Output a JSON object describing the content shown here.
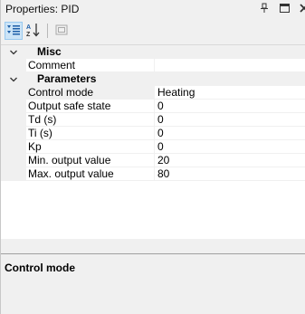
{
  "window": {
    "title": "Properties: PID"
  },
  "toolbar": {
    "categorized_icon": "categorized-icon",
    "alphabetical_icon": "sort-az-icon",
    "property_pages_icon": "property-pages-icon"
  },
  "grid": {
    "categories": [
      {
        "label": "Misc",
        "expanded": true,
        "properties": [
          {
            "name": "Comment",
            "value": ""
          }
        ]
      },
      {
        "label": "Parameters",
        "expanded": true,
        "properties": [
          {
            "name": "Control mode",
            "value": "Heating"
          },
          {
            "name": "Output safe state",
            "value": "0"
          },
          {
            "name": "Td (s)",
            "value": "0"
          },
          {
            "name": "Ti (s)",
            "value": "0"
          },
          {
            "name": "Kp",
            "value": "0"
          },
          {
            "name": "Min. output value",
            "value": "20"
          },
          {
            "name": "Max. output value",
            "value": "80"
          }
        ]
      }
    ]
  },
  "description": {
    "title": "Control mode"
  }
}
